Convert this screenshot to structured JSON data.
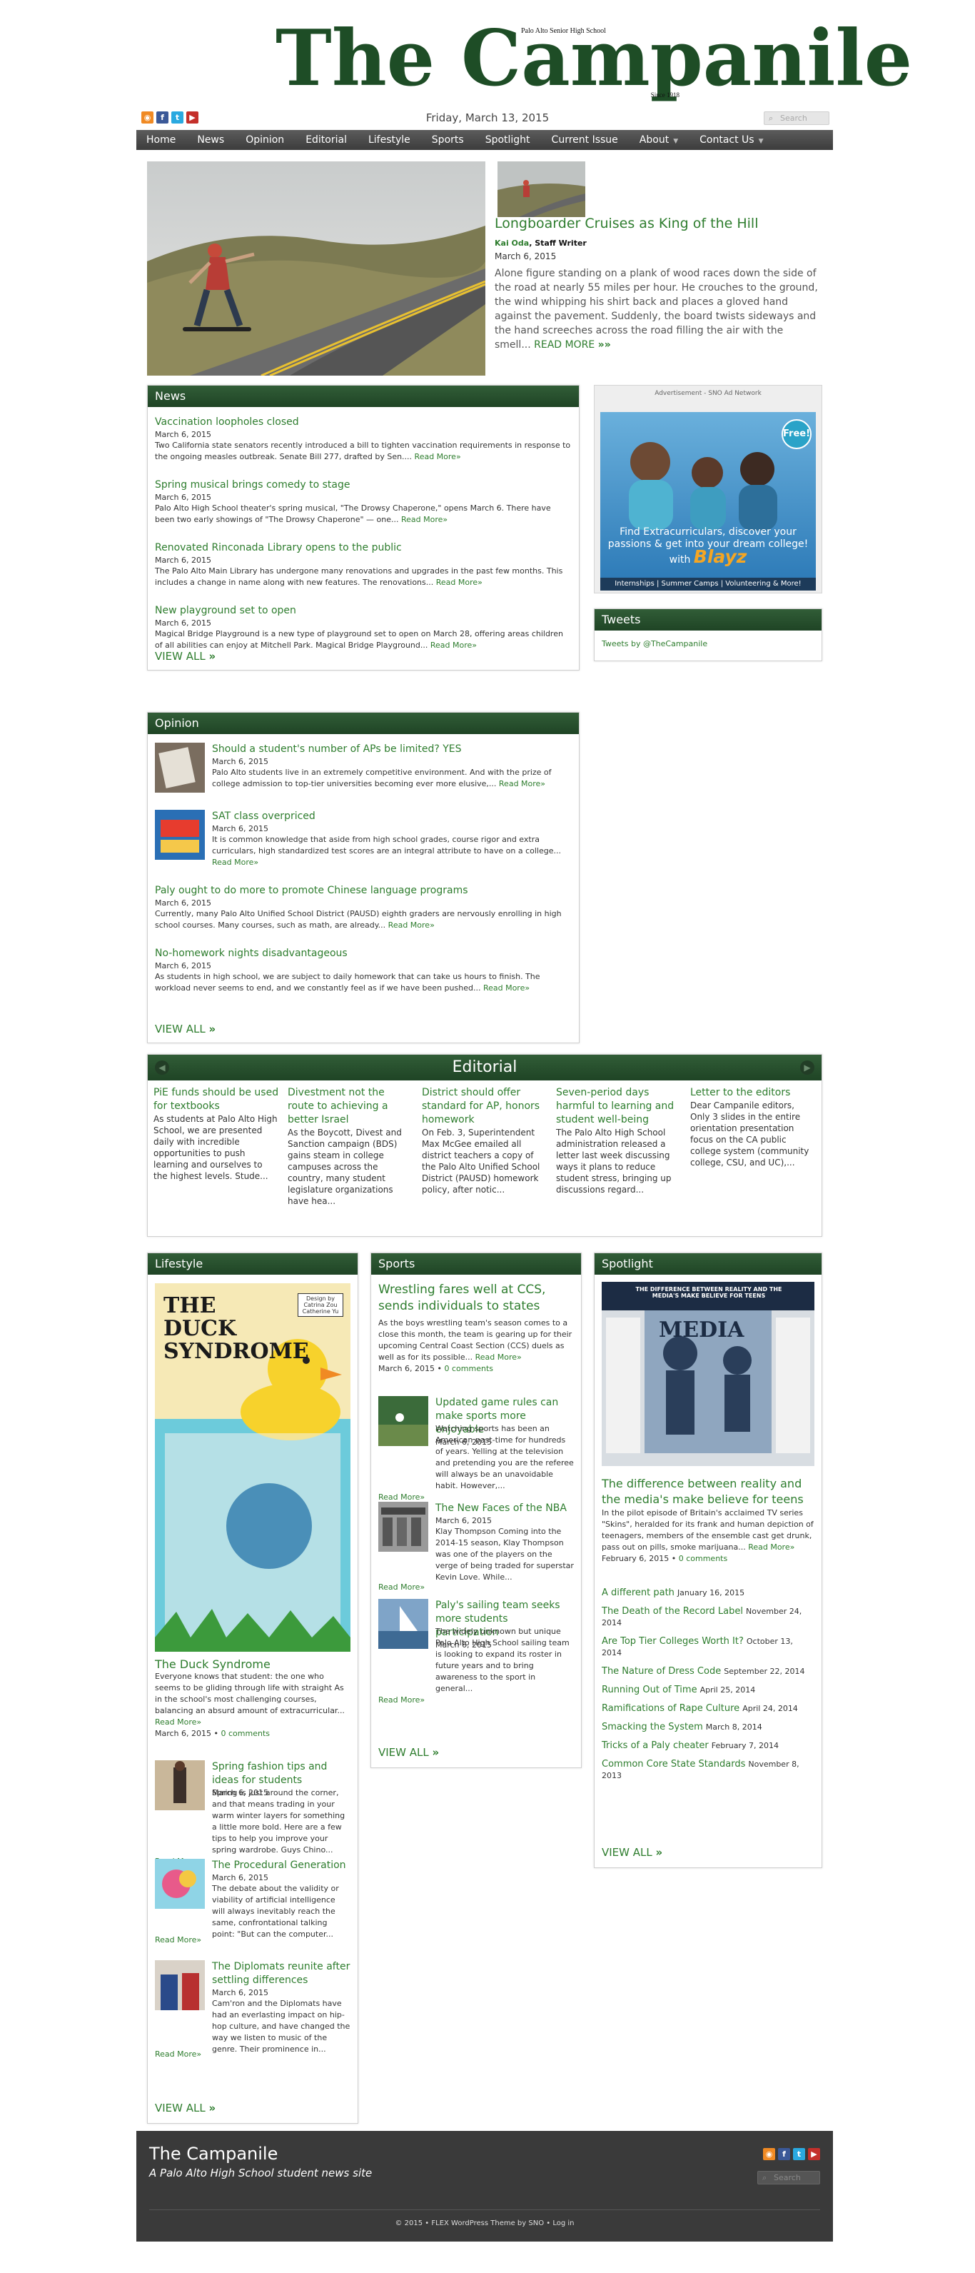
{
  "header": {
    "logo": "The Campanile",
    "school": "Palo Alto Senior High School",
    "since": "Since 1918",
    "date": "Friday, March 13, 2015",
    "search_placeholder": "Search",
    "social_icons": [
      "rss-icon",
      "facebook-icon",
      "twitter-icon",
      "youtube-icon"
    ]
  },
  "nav": {
    "items": [
      "Home",
      "News",
      "Opinion",
      "Editorial",
      "Lifestyle",
      "Sports",
      "Spotlight",
      "Current Issue",
      "About",
      "Contact Us"
    ]
  },
  "featured": {
    "title": "Longboarder Cruises as King of the Hill",
    "author": "Kai Oda",
    "author_role": "Staff Writer",
    "date": "March 6, 2015",
    "text": "Alone figure standing on a plank of wood races down the side of the road at nearly 55 miles per hour. He crouches to the ground, the wind whipping his shirt back and places a gloved hand against the pavement. Suddenly, the board twists sideways and the hand screeches across the road filling the air with the smell...",
    "read_more": "READ MORE"
  },
  "news": {
    "heading": "News",
    "items": [
      {
        "title": "Vaccination loopholes closed",
        "date": "March 6, 2015",
        "excerpt": "Two California state senators recently introduced a bill to tighten vaccination requirements in response to the ongoing measles outbreak. Senate Bill 277, drafted by Sen....",
        "rm": "Read More»"
      },
      {
        "title": "Spring musical brings comedy to stage",
        "date": "March 6, 2015",
        "excerpt": "Palo Alto High School theater's spring musical, \"The Drowsy Chaperone,\" opens March 6. There have been two early showings of \"The Drowsy Chaperone\" — one...",
        "rm": "Read More»"
      },
      {
        "title": "Renovated Rinconada Library opens to the public",
        "date": "March 6, 2015",
        "excerpt": "The Palo Alto Main Library has undergone many renovations and upgrades in the past few months. This includes a change in name along with new features. The renovations...",
        "rm": "Read More»"
      },
      {
        "title": "New playground set to open",
        "date": "March 6, 2015",
        "excerpt": "Magical Bridge Playground is a new type of playground set to open on March 28, offering areas children of all abilities can enjoy at Mitchell Park. Magical Bridge Playground...",
        "rm": "Read More»"
      }
    ],
    "view_all": "VIEW ALL"
  },
  "ad": {
    "label": "Advertisement - SNO Ad Network",
    "free": "Free!",
    "line1": "Find Extracurriculars, discover your passions & get into your dream college!",
    "with": "with",
    "brand": "Blayz",
    "bottom": "Internships | Summer Camps | Volunteering & More!"
  },
  "tweets": {
    "heading": "Tweets",
    "link": "Tweets by @TheCampanile"
  },
  "opinion": {
    "heading": "Opinion",
    "items": [
      {
        "title": "Should a student's number of APs be limited? YES",
        "date": "March 6, 2015",
        "excerpt": "Palo Alto students live in an extremely competitive environment. And with the prize of college admission to top-tier universities becoming ever more elusive,...",
        "rm": "Read More»"
      },
      {
        "title": "SAT class overpriced",
        "date": "March 6, 2015",
        "excerpt": "It is common knowledge that aside from high school grades, course rigor and extra curriculars, high standardized test scores are an integral attribute to have on a college...",
        "rm": "Read More»"
      },
      {
        "title": "Paly ought to do more to promote Chinese language programs",
        "date": "March 6, 2015",
        "excerpt": "Currently, many Palo Alto Unified School District (PAUSD) eighth graders are nervously enrolling in high school courses. Many courses, such as math, are already...",
        "rm": "Read More»"
      },
      {
        "title": "No-homework nights disadvantageous",
        "date": "March 6, 2015",
        "excerpt": "As students in high school, we are subject to daily homework that can take us hours to finish. The workload never seems to end, and we constantly feel as if we have been pushed...",
        "rm": "Read More»"
      }
    ],
    "view_all": "VIEW ALL"
  },
  "editorial": {
    "heading": "Editorial",
    "items": [
      {
        "title": "PiE funds should be used for textbooks",
        "excerpt": "As students at Palo Alto High School, we are presented daily with incredible opportunities to push learning and ourselves to the highest levels. Stude..."
      },
      {
        "title": "Divestment not the route to achieving a better Israel",
        "excerpt": "As the Boycott, Divest and Sanction campaign (BDS) gains steam in college campuses across the country, many student legislature organizations have hea..."
      },
      {
        "title": "District should offer standard for AP, honors homework",
        "excerpt": "On Feb. 3, Superintendent Max McGee emailed all district teachers a copy of the Palo Alto Unified School District (PAUSD) homework policy, after notic..."
      },
      {
        "title": "Seven-period days harmful to learning and student well-being",
        "excerpt": "The Palo Alto High School administration released a letter last week discussing ways it plans to reduce student stress, bringing up discussions regard..."
      },
      {
        "title": "Letter to the editors",
        "excerpt": "Dear Campanile editors, Only 3 slides in the entire orientation presentation focus on the CA public college system (community college, CSU, and UC),..."
      }
    ]
  },
  "lifestyle": {
    "heading": "Lifestyle",
    "cover": {
      "title": "THE DUCK SYNDROME",
      "design": "Design by Catrina Zou Catherine Yu"
    },
    "lead": {
      "title": "The Duck Syndrome",
      "excerpt": "Everyone knows that student: the one who seems to be gliding through life with straight As in the school's most challenging courses, balancing an absurd amount of extracurricular...",
      "rm": "Read More»",
      "date": "March 6, 2015",
      "comments": "0 comments"
    },
    "items": [
      {
        "title": "Spring fashion tips and ideas for students",
        "date": "March 6, 2015",
        "excerpt": "Spring is just around the corner, and that means trading in your warm winter layers for something a little more bold. Here are a few tips to help you improve your spring wardrobe. Guys Chino...",
        "rm": "Read More»"
      },
      {
        "title": "The Procedural Generation",
        "date": "March 6, 2015",
        "excerpt": "The debate about the validity or viability of artificial intelligence will always inevitably reach the same, confrontational talking point: \"But can the computer...",
        "rm": "Read More»"
      },
      {
        "title": "The Diplomats reunite after settling differences",
        "date": "March 6, 2015",
        "excerpt": "Cam'ron and the Diplomats have had an everlasting impact on hip-hop culture, and have changed the way we listen to music of the genre. Their prominence in...",
        "rm": "Read More»"
      }
    ],
    "view_all": "VIEW ALL"
  },
  "sports": {
    "heading": "Sports",
    "lead": {
      "title": "Wrestling fares well at CCS, sends individuals to states",
      "excerpt": "As the boys wrestling team's season comes to a close this month, the team is gearing up for their upcoming Central Coast Section (CCS) duels as well as for its possible...",
      "rm": "Read More»",
      "date": "March 6, 2015",
      "comments": "0 comments"
    },
    "items": [
      {
        "title": "Updated game rules can make sports more enjoyable",
        "date": "March 6, 2015",
        "excerpt": "Watching sports has been an American past-time for hundreds of years. Yelling at the television and pretending you are the referee will always be an unavoidable habit. However,...",
        "rm": "Read More»"
      },
      {
        "title": "The New Faces of the NBA",
        "date": "March 6, 2015",
        "excerpt": "Klay Thompson Coming into the 2014-15 season, Klay Thompson was one of the players on the verge of being traded for superstar Kevin Love. While...",
        "rm": "Read More»"
      },
      {
        "title": "Paly's sailing team seeks more students participation",
        "date": "March 6, 2015",
        "excerpt": "The widely unknown but unique Palo Alto High School sailing team is looking to expand its roster in future years and to bring awareness to the sport in general...",
        "rm": "Read More»"
      }
    ],
    "view_all": "VIEW ALL"
  },
  "spotlight": {
    "heading": "Spotlight",
    "cover": {
      "title": "THE DIFFERENCE BETWEEN REALITY AND THE MEDIA'S MAKE BELIEVE FOR TEENS",
      "word": "MEDIA"
    },
    "lead": {
      "title": "The difference between reality and the media's make believe for teens",
      "excerpt": "In the pilot episode of Britain's acclaimed TV series \"Skins\", heralded for its frank and human depiction of teenagers, members of the ensemble cast get drunk, pass out on pills, smoke marijuana...",
      "rm": "Read More»",
      "date": "February 6, 2015",
      "comments": "0 comments"
    },
    "list": [
      {
        "title": "A different path",
        "date": "January 16, 2015"
      },
      {
        "title": "The Death of the Record Label",
        "date": "November 24, 2014"
      },
      {
        "title": "Are Top Tier Colleges Worth It?",
        "date": "October 13, 2014"
      },
      {
        "title": "The Nature of Dress Code",
        "date": "September 22, 2014"
      },
      {
        "title": "Running Out of Time",
        "date": "April 25, 2014"
      },
      {
        "title": "Ramifications of Rape Culture",
        "date": "April 24, 2014"
      },
      {
        "title": "Smacking the System",
        "date": "March 8, 2014"
      },
      {
        "title": "Tricks of a Paly cheater",
        "date": "February 7, 2014"
      },
      {
        "title": "Common Core State Standards",
        "date": "November 8, 2013"
      }
    ],
    "view_all": "VIEW ALL"
  },
  "footer": {
    "name": "The Campanile",
    "tagline": "A Palo Alto High School student news site",
    "search_placeholder": "Search",
    "copyright": "© 2015 • FLEX WordPress Theme by SNO • Log in"
  }
}
